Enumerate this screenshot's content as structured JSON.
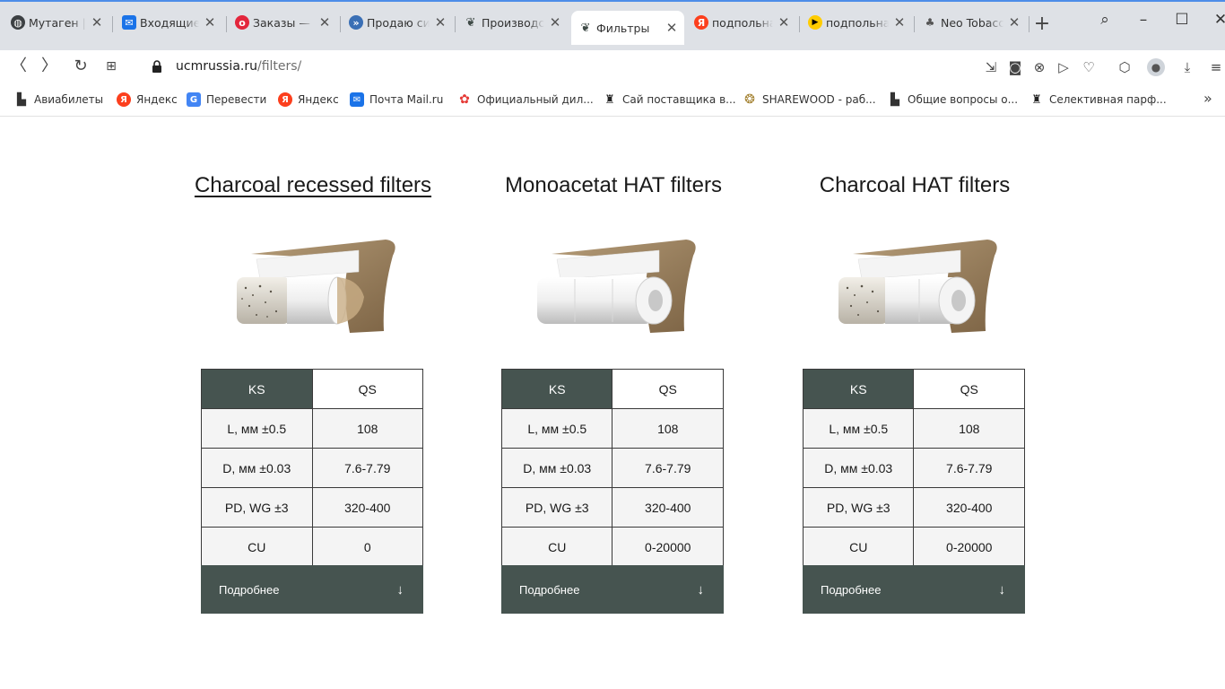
{
  "tabs": [
    {
      "title": "Мутаген | С",
      "icon": "globe-icon",
      "color": "#3c4043",
      "active": false
    },
    {
      "title": "Входящие - ",
      "icon": "mail-icon",
      "color": "#1a73e8",
      "active": false
    },
    {
      "title": "Заказы — С",
      "icon": "ozon-icon",
      "color": "#e3263c",
      "active": false
    },
    {
      "title": "Продаю си",
      "icon": "forum-icon",
      "color": "#3a6fb5",
      "active": false
    },
    {
      "title": "Производс",
      "icon": "ucm-icon",
      "color": "#3f4b47",
      "active": false
    },
    {
      "title": "Фильтры",
      "icon": "ucm-icon",
      "color": "#3f4b47",
      "active": true
    },
    {
      "title": "подпольна",
      "icon": "yandex-icon",
      "color": "#fc3f1d",
      "active": false
    },
    {
      "title": "подпольна",
      "icon": "play-icon",
      "color": "#ffcc00",
      "active": false
    },
    {
      "title": "Neo Tobacc",
      "icon": "neo-icon",
      "color": "#555555",
      "active": false
    }
  ],
  "address": {
    "host": "ucmrussia.ru",
    "path": "/filters/"
  },
  "bookmarks": [
    {
      "label": "Авиабилеты",
      "icon": "page-icon",
      "color": "#333333"
    },
    {
      "label": "Яндекс",
      "icon": "yandex-icon",
      "color": "#fc3f1d"
    },
    {
      "label": "Перевести",
      "icon": "translate-icon",
      "color": "#4285f4"
    },
    {
      "label": "Яндекс",
      "icon": "yandex-icon",
      "color": "#fc3f1d"
    },
    {
      "label": "Почта Mail.ru",
      "icon": "mail-icon",
      "color": "#1a73e8"
    },
    {
      "label": "Официальный дил...",
      "icon": "flower-icon",
      "color": "#e53935"
    },
    {
      "label": "Сай поставщика в...",
      "icon": "vape-icon",
      "color": "#222222"
    },
    {
      "label": "SHAREWOOD - раб...",
      "icon": "sharewood-icon",
      "color": "#a07d2a"
    },
    {
      "label": "Общие вопросы о...",
      "icon": "page-icon",
      "color": "#333333"
    },
    {
      "label": "Селективная парф...",
      "icon": "vape-icon",
      "color": "#222222"
    }
  ],
  "products": [
    {
      "title": "Charcoal recessed filters",
      "linked": true,
      "image": "charcoal-recessed",
      "header": [
        "KS",
        "QS"
      ],
      "rows": [
        [
          "L, мм ±0.5",
          "108"
        ],
        [
          "D, мм ±0.03",
          "7.6-7.79"
        ],
        [
          "PD, WG ±3",
          "320-400"
        ],
        [
          "CU",
          "0"
        ]
      ],
      "more_label": "Подробнее",
      "more_arrow": "↓"
    },
    {
      "title": "Monoacetat HAT filters",
      "linked": false,
      "image": "monoacetat-hat",
      "header": [
        "KS",
        "QS"
      ],
      "rows": [
        [
          "L, мм ±0.5",
          "108"
        ],
        [
          "D, мм ±0.03",
          "7.6-7.79"
        ],
        [
          "PD, WG ±3",
          "320-400"
        ],
        [
          "CU",
          "0-20000"
        ]
      ],
      "more_label": "Подробнее",
      "more_arrow": "↓"
    },
    {
      "title": "Charcoal HAT filters",
      "linked": false,
      "image": "charcoal-hat",
      "header": [
        "KS",
        "QS"
      ],
      "rows": [
        [
          "L, мм ±0.5",
          "108"
        ],
        [
          "D, мм ±0.03",
          "7.6-7.79"
        ],
        [
          "PD, WG ±3",
          "320-400"
        ],
        [
          "CU",
          "0-20000"
        ]
      ],
      "more_label": "Подробнее",
      "more_arrow": "↓"
    }
  ],
  "colors": {
    "accent": "#465450",
    "tabstrip": "#dee1e6"
  }
}
